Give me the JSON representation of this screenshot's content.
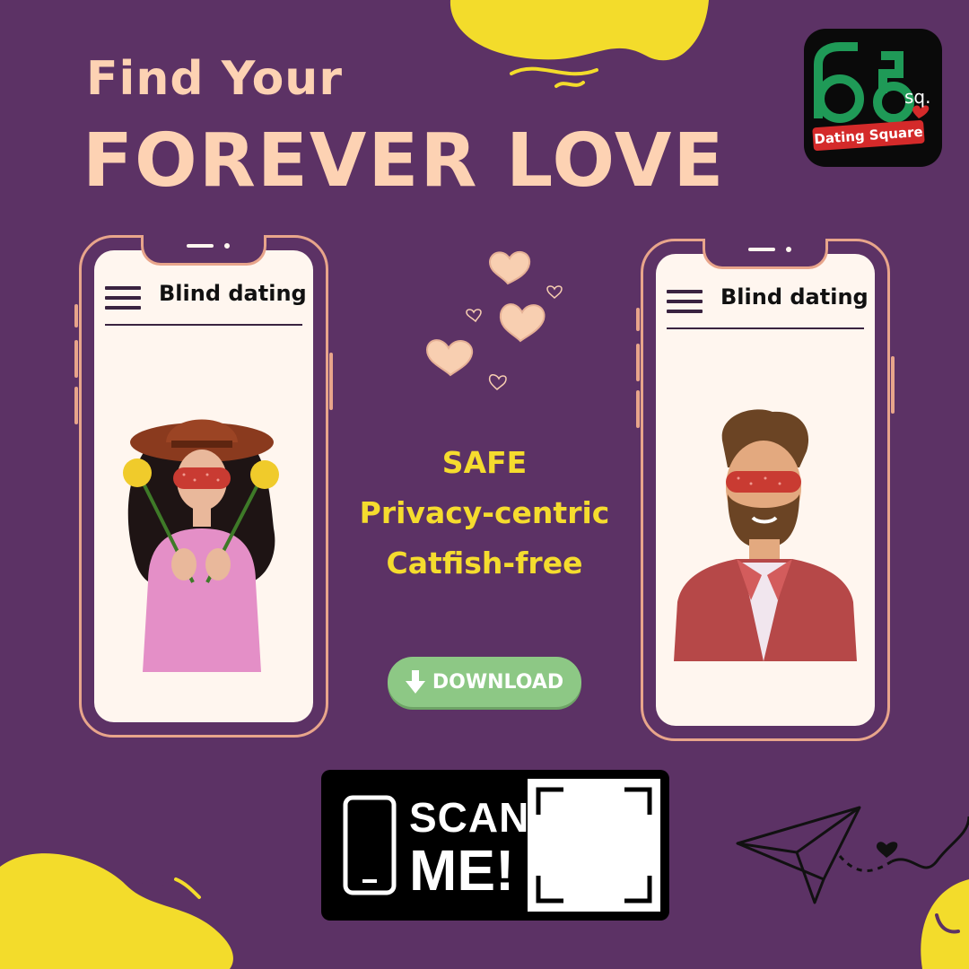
{
  "headline": {
    "line1": "Find Your",
    "line2": "FOREVER LOVE"
  },
  "logo": {
    "mark": "sq.",
    "banner": "Dating Square"
  },
  "phones": [
    {
      "title": "Blind dating",
      "illustration": "woman-with-sleep-mask-holding-flowers"
    },
    {
      "title": "Blind dating",
      "illustration": "bearded-man-with-sleep-mask"
    }
  ],
  "features": [
    "SAFE",
    "Privacy-centric",
    "Catfish-free"
  ],
  "download_button": {
    "label": "DOWNLOAD",
    "icon": "arrow-down-icon"
  },
  "scan_badge": {
    "line1": "SCAN",
    "line2": "ME!"
  },
  "colors": {
    "background": "#5c3265",
    "headline": "#fdd2b3",
    "feature_text": "#f5dc2e",
    "download": "#8dc885",
    "accent_yellow": "#f3dc2b",
    "phone_border": "#e8a58b"
  }
}
